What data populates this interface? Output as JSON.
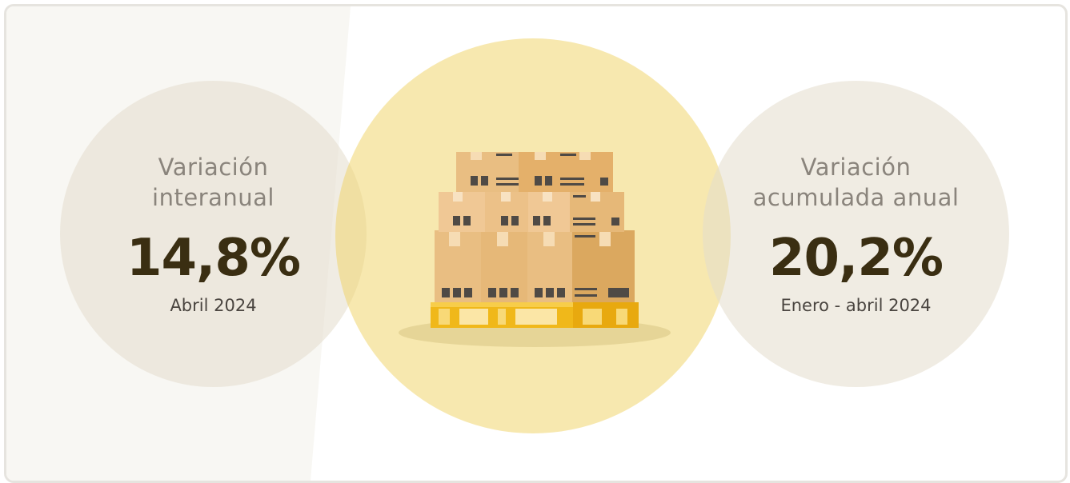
{
  "stats": [
    {
      "title_line1": "Variación",
      "title_line2": "interanual",
      "value": "14,8%",
      "period": "Abril 2024"
    },
    {
      "title_line1": "Variación",
      "title_line2": "acumulada anual",
      "value": "20,2%",
      "period": "Enero - abril 2024"
    }
  ],
  "colors": {
    "stat_circle": "#efeae0",
    "center_circle": "#f6e3a4",
    "value_text": "#3a2e12",
    "title_text": "#8a847c",
    "pallet": "#f0b81a",
    "box": "#e4b36e"
  },
  "illustration": {
    "icon": "boxes-on-pallet-icon"
  }
}
